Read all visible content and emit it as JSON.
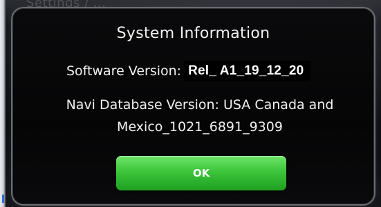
{
  "background": {
    "title_text": "Settings / ..."
  },
  "dialog": {
    "title": "System Information",
    "software_version_label": "Software Version:",
    "software_version_value": "Rel_ A1_19_12_20",
    "navi_database_text": "Navi Database Version: USA Canada and Mexico_1021_6891_9309",
    "ok_label": "OK"
  },
  "colors": {
    "dialog_background": "#060607",
    "dialog_border": "#6c6d72",
    "ok_button": "#3cc53a",
    "text": "#f0f0f0",
    "highlight_box": "#000000"
  }
}
